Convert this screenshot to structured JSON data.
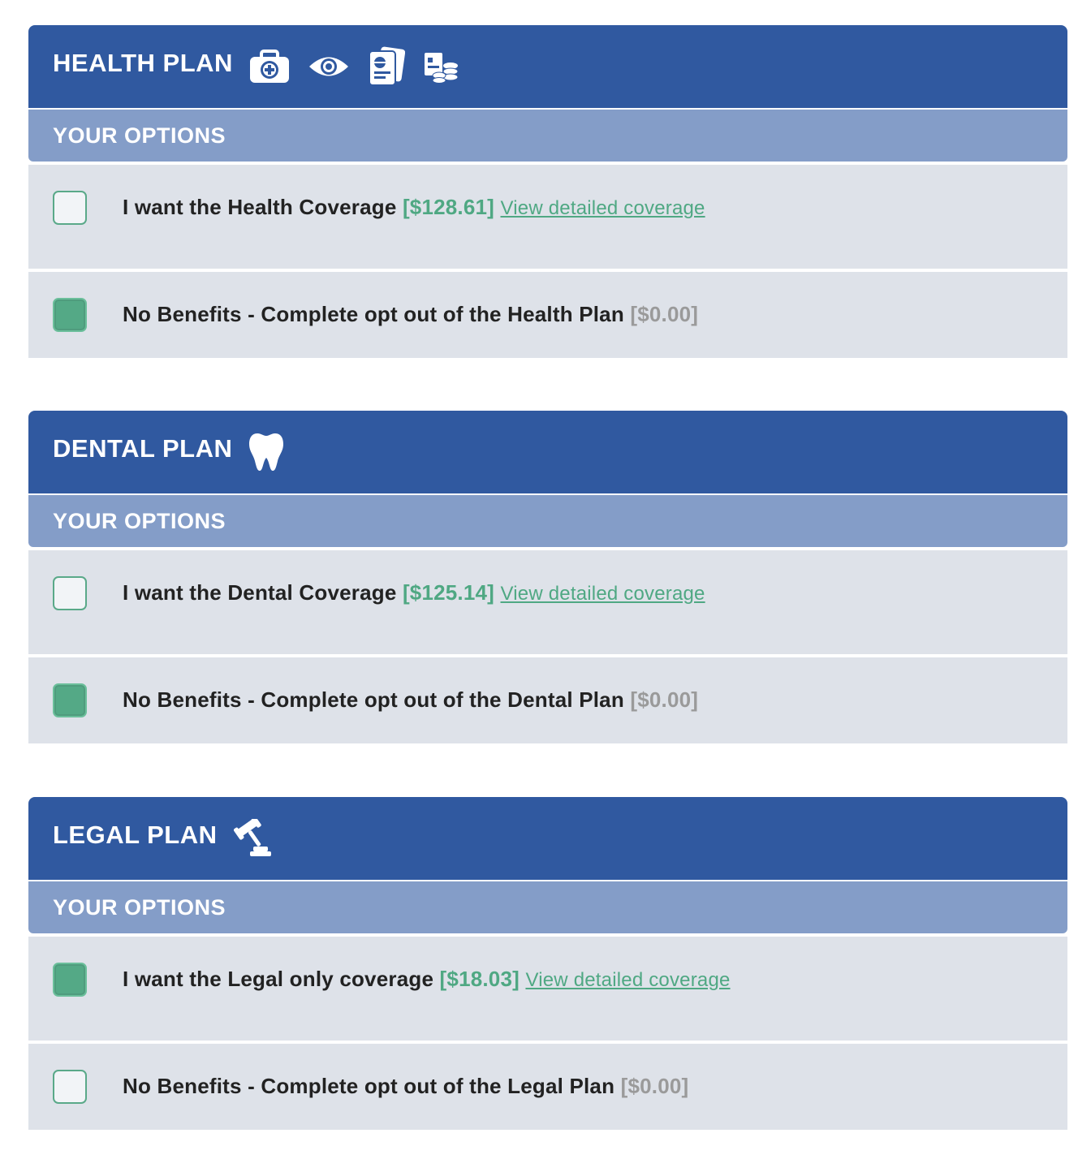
{
  "plans": [
    {
      "title": "HEALTH PLAN",
      "icons": [
        "medical-kit-icon",
        "eye-icon",
        "id-card-icon",
        "money-icon"
      ],
      "options_label": "YOUR OPTIONS",
      "options": [
        {
          "text": "I want the Health Coverage",
          "price": "[$128.61]",
          "link": "View detailed coverage",
          "checked": false
        },
        {
          "text": "No Benefits - Complete opt out of the Health Plan",
          "price": "[$0.00]",
          "checked": true
        }
      ]
    },
    {
      "title": "DENTAL PLAN",
      "icons": [
        "tooth-icon"
      ],
      "options_label": "YOUR OPTIONS",
      "options": [
        {
          "text": "I want the Dental Coverage",
          "price": "[$125.14]",
          "link": "View detailed coverage",
          "checked": false
        },
        {
          "text": "No Benefits - Complete opt out of the Dental Plan",
          "price": "[$0.00]",
          "checked": true
        }
      ]
    },
    {
      "title": "LEGAL PLAN",
      "icons": [
        "gavel-icon"
      ],
      "options_label": "YOUR OPTIONS",
      "options": [
        {
          "text": "I want the Legal only coverage",
          "price": "[$18.03]",
          "link": "View detailed coverage",
          "checked": true
        },
        {
          "text": "No Benefits - Complete opt out of the Legal Plan",
          "price": "[$0.00]",
          "checked": false
        }
      ]
    }
  ],
  "colors": {
    "header": "#3059a0",
    "options_bar": "#849dc8",
    "row": "#dee2e9",
    "accent": "#54a986",
    "price_zero": "#9a9a9a"
  }
}
